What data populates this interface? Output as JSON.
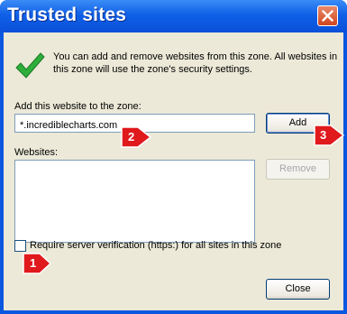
{
  "dialog": {
    "title": "Trusted sites",
    "intro": "You can add and remove websites from this zone. All websites in this zone will use the zone's security settings.",
    "add_label": "Add this website to the zone:",
    "site_input_value": "*.incrediblecharts.com",
    "add_button": "Add",
    "websites_label": "Websites:",
    "remove_button": "Remove",
    "require_https_label": "Require server verification (https:) for all sites in this zone",
    "require_https_checked": false,
    "close_button": "Close"
  },
  "annotations": {
    "marker_1": "1",
    "marker_2": "2",
    "marker_3": "3"
  },
  "colors": {
    "titlebar": "#0a50d8",
    "dialog_bg": "#ece9d8",
    "marker": "#e0191c"
  }
}
